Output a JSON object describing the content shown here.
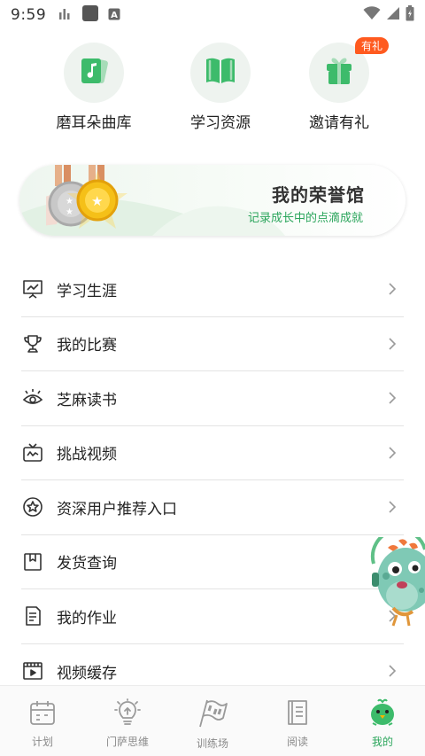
{
  "status_bar": {
    "time": "9:59",
    "left_icons": [
      "signal-bars-icon",
      "notification-square-icon",
      "a-badge-icon"
    ],
    "right_icons": [
      "wifi-icon",
      "cellular-icon",
      "battery-icon"
    ]
  },
  "quick_entries": [
    {
      "label": "磨耳朵曲库",
      "icon": "music-cards-icon"
    },
    {
      "label": "学习资源",
      "icon": "open-book-icon"
    },
    {
      "label": "邀请有礼",
      "icon": "gift-icon",
      "badge": "有礼"
    }
  ],
  "honor_banner": {
    "title": "我的荣誉馆",
    "subtitle": "记录成长中的点滴成就"
  },
  "menu": [
    {
      "label": "学习生涯",
      "icon": "presentation-chart-icon"
    },
    {
      "label": "我的比赛",
      "icon": "trophy-icon"
    },
    {
      "label": "芝麻读书",
      "icon": "reading-eye-icon"
    },
    {
      "label": "挑战视频",
      "icon": "tv-icon"
    },
    {
      "label": "资深用户推荐入口",
      "icon": "star-circle-icon"
    },
    {
      "label": "发货查询",
      "icon": "package-icon"
    },
    {
      "label": "我的作业",
      "icon": "document-icon"
    },
    {
      "label": "视频缓存",
      "icon": "video-frame-icon"
    }
  ],
  "tabs": [
    {
      "label": "计划",
      "icon": "calendar-icon",
      "active": false
    },
    {
      "label": "门萨思维",
      "icon": "lightbulb-icon",
      "active": false
    },
    {
      "label": "训练场",
      "icon": "flag-icon",
      "active": false
    },
    {
      "label": "阅读",
      "icon": "book-icon",
      "active": false
    },
    {
      "label": "我的",
      "icon": "chick-icon",
      "active": true
    }
  ],
  "colors": {
    "accent_green": "#2aa55b",
    "icon_green": "#3dbb6b",
    "badge_orange": "#ff5a1f",
    "divider": "#e3e3e3"
  }
}
